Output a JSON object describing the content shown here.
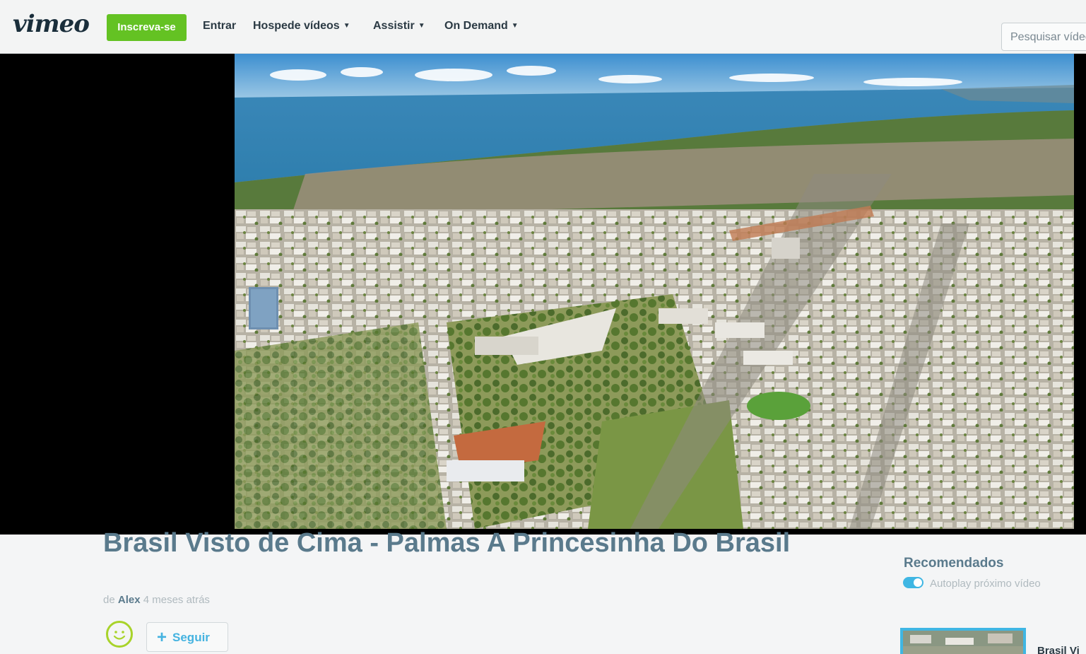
{
  "header": {
    "logo": "vimeo",
    "signup_label": "Inscreva-se",
    "nav": [
      {
        "label": "Entrar",
        "has_menu": false
      },
      {
        "label": "Hospede vídeos",
        "has_menu": true
      },
      {
        "label": "Assistir",
        "has_menu": true
      },
      {
        "label": "On Demand",
        "has_menu": true
      }
    ],
    "search_placeholder": "Pesquisar vídeos"
  },
  "video": {
    "title": "Brasil Visto de Cima - Palmas A Princesinha Do Brasil",
    "by_prefix": "de",
    "author": "Alex",
    "time_ago": "4 meses atrás",
    "follow_label": "Seguir"
  },
  "sidebar": {
    "recommended_title": "Recomendados",
    "autoplay_label": "Autoplay próximo vídeo",
    "autoplay_on": true,
    "first_item_title": "Brasil Vi"
  },
  "colors": {
    "brand_green": "#64c223",
    "accent_blue": "#3fb6e3",
    "title_slate": "#5a7a8c"
  }
}
